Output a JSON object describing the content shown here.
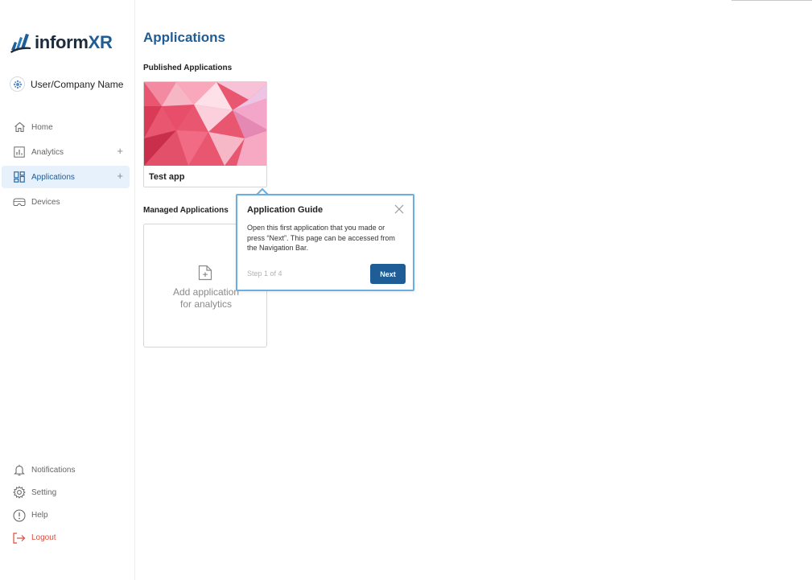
{
  "brand": {
    "logo_prefix": "inform",
    "logo_suffix": "XR",
    "logo_color": "#1e5d96"
  },
  "user": {
    "name": "User/Company Name"
  },
  "sidebar": {
    "items": [
      {
        "label": "Home",
        "icon": "home-icon"
      },
      {
        "label": "Analytics",
        "icon": "analytics-icon",
        "expand": "+"
      },
      {
        "label": "Applications",
        "icon": "applications-icon",
        "expand": "+",
        "active": true
      },
      {
        "label": "Devices",
        "icon": "devices-icon"
      }
    ],
    "bottom_items": [
      {
        "label": "Notifications",
        "icon": "bell-icon"
      },
      {
        "label": "Setting",
        "icon": "gear-icon"
      },
      {
        "label": "Help",
        "icon": "help-icon"
      },
      {
        "label": "Logout",
        "icon": "logout-icon",
        "color": "#e04b3e"
      }
    ]
  },
  "main": {
    "title": "Applications",
    "published_title": "Published Applications",
    "published_apps": [
      {
        "name": "Test app"
      }
    ],
    "managed_title": "Managed Applications",
    "add_card": {
      "line1": "Add application",
      "line2": "for analytics"
    }
  },
  "guide": {
    "title": "Application Guide",
    "body": "Open this first application that you made or press “Next”. This page can be accessed from the Navigation Bar.",
    "step": "Step 1 of 4",
    "next_label": "Next"
  },
  "colors": {
    "accent": "#1e5d96",
    "active_bg": "#e7f1fb",
    "popover_border": "#6aaee2"
  }
}
